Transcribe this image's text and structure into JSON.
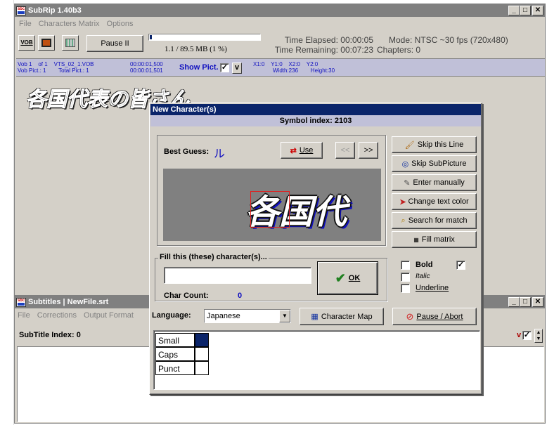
{
  "subrip": {
    "title": "SubRip 1.40b3",
    "menu": [
      "File",
      "Characters Matrix",
      "Options"
    ],
    "toolbar": {
      "vob_icon": "vob-icon",
      "film_icon": "film-icon",
      "picture_icon": "picture-icon",
      "pause_label": "Pause II",
      "progress_text": "1.1 / 89.5 MB (1 %)",
      "progress_fraction": 0.012,
      "time_elapsed": "Time Elapsed: 00:00:05",
      "time_remaining": "Time Remaining: 00:07:23",
      "mode": "Mode: NTSC ~30 fps (720x480)",
      "chapters": "Chapters: 0"
    },
    "info": {
      "vob_line1": "Vob 1    of 1    VTS_02_1.VOB",
      "vob_line2": "Vob Pict.: 1        Total Pict.: 1",
      "time1": "00:00:01,500",
      "time2": "00:00:01,501",
      "show_pict": "Show Pict.",
      "show_pict_check": "✓",
      "v_label": "v",
      "coords1": "X1:0    Y1:0    X2:0    Y2:0",
      "coords2": "Width:236        Height:30"
    },
    "preview_text": "各国代表の皆さん"
  },
  "subtitles": {
    "title": "Subtitles | NewFile.srt",
    "menu": [
      "File",
      "Corrections",
      "Output Format"
    ],
    "index_label": "SubTitle Index: 0",
    "v_label": "v",
    "v_check": "✓"
  },
  "dialog": {
    "title": "New Character(s)",
    "symbol_index": "Symbol index: 2103",
    "best_guess_label": "Best Guess:",
    "best_guess_char": "ル",
    "use_label": "Use",
    "prev_label": "<<",
    "next_label": ">>",
    "preview_text": "各国代",
    "fill_legend": "Fill this (these) character(s)...",
    "fill_value": "",
    "char_count_label": "Char Count:",
    "char_count_value": "0",
    "ok_label": "OK",
    "right_buttons": [
      {
        "label": "Skip this Line",
        "icon": "brush-icon"
      },
      {
        "label": "Skip SubPicture",
        "icon": "binoculars-icon"
      },
      {
        "label": "Enter manually",
        "icon": "pencil-icon"
      },
      {
        "label": "Change text color",
        "icon": "color-arrow-icon"
      },
      {
        "label": "Search for match",
        "icon": "search-match-icon"
      },
      {
        "label": "Fill matrix",
        "icon": "matrix-icon"
      }
    ],
    "bold_label": "Bold",
    "bold_check": "✓",
    "italic_label": "Italic",
    "underline_label": "Underline",
    "language_label": "Language:",
    "language_value": "Japanese",
    "character_map_label": "Character Map",
    "pause_abort_label": "Pause / Abort",
    "matrix_rows": [
      "Small",
      "Caps",
      "Punct"
    ]
  },
  "colors": {
    "selection_blue": "#0a246a",
    "char_blue": "#1010c0",
    "preview_gray": "#808080"
  }
}
